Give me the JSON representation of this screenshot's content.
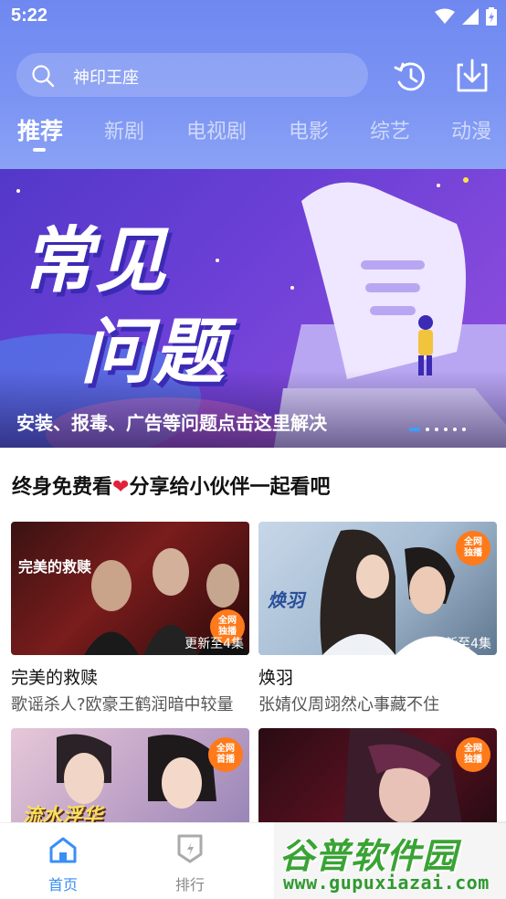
{
  "status_bar": {
    "time": "5:22"
  },
  "search": {
    "query": "神印王座"
  },
  "tabs": [
    {
      "label": "推荐",
      "active": true
    },
    {
      "label": "新剧",
      "active": false
    },
    {
      "label": "电视剧",
      "active": false
    },
    {
      "label": "电影",
      "active": false
    },
    {
      "label": "综艺",
      "active": false
    },
    {
      "label": "动漫",
      "active": false
    }
  ],
  "banner": {
    "title_line_1": "常见",
    "title_line_2": "问题",
    "caption": "安装、报毒、广告等问题点击这里解决",
    "page_count": 6,
    "active_page": 1
  },
  "section": {
    "title_prefix": "终身免费看",
    "title_heart": "❤",
    "title_suffix": "分享给小伙伴一起看吧"
  },
  "cards": [
    {
      "title": "完美的救赎",
      "subtitle": "歌谣杀人?欧豪王鹤润暗中较量",
      "badge": "更新至4集",
      "poster_text": "完美的救赎",
      "tag": "全网\n独播"
    },
    {
      "title": "焕羽",
      "subtitle": "张婧仪周翊然心事藏不住",
      "badge": "更新至4集",
      "poster_text": "焕羽",
      "tag": "全网\n独播"
    },
    {
      "title": "",
      "subtitle": "",
      "badge": "",
      "poster_text": "流水浮华",
      "tag": "全网\n首播"
    },
    {
      "title": "",
      "subtitle": "",
      "badge": "",
      "poster_text": "",
      "tag": "全网\n独播"
    }
  ],
  "bottom_nav": [
    {
      "label": "首页",
      "active": true
    },
    {
      "label": "排行",
      "active": false
    }
  ],
  "watermark": {
    "title": "谷普软件园",
    "url": "www.gupuxiazai.com"
  },
  "colors": {
    "accent": "#3a8ff5",
    "header_top": "#6f88f0",
    "heart": "#e3203a",
    "tag_orange": "#ff7a1a",
    "watermark_green": "#3aa335"
  }
}
